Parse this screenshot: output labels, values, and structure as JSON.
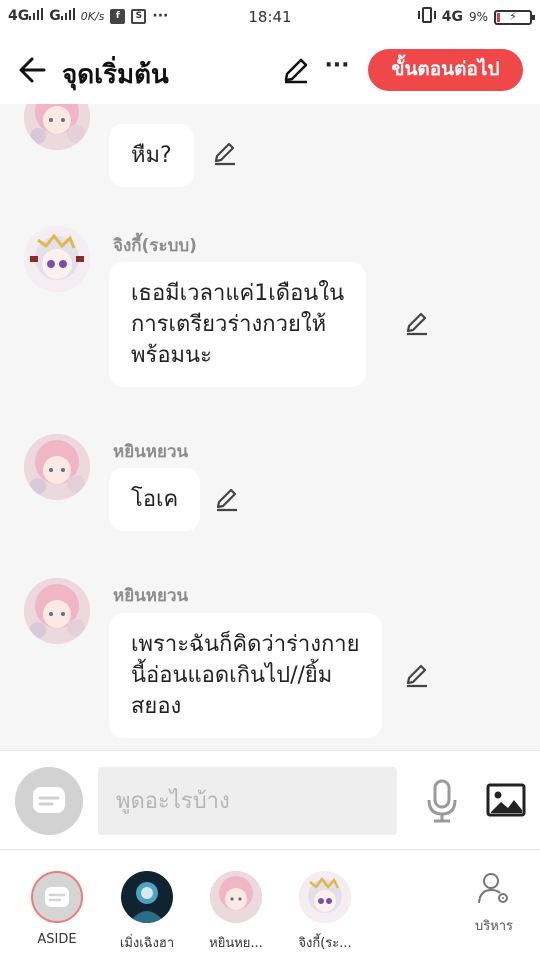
{
  "status_bar": {
    "network_left": "4G",
    "network_left2": "G",
    "speed": "0K/s",
    "app_box_1": "f",
    "app_box_2": "S",
    "more": "···",
    "time": "18:41",
    "network_right": "4G",
    "battery_pct": "9%",
    "battery_level": 0.09,
    "battery_color": "#e23b3b"
  },
  "header": {
    "title": "จุดเริ่มต้น",
    "more_label": "···",
    "next_label": "ขั้นตอนต่อไป",
    "accent_color": "#f04848"
  },
  "messages": [
    {
      "sender": "",
      "avatar": "pink-girl",
      "lines": [
        "หืม?"
      ]
    },
    {
      "sender": "จิงกี้(ระบบ)",
      "avatar": "chibi-girl",
      "lines": [
        "เธอมีเวลาแค่1เดือนใน",
        "การเตรียวร่างกวยให้",
        "พร้อมนะ"
      ]
    },
    {
      "sender": "หยินหยวน",
      "avatar": "pink-girl",
      "lines": [
        "โอเค"
      ]
    },
    {
      "sender": "หยินหยวน",
      "avatar": "pink-girl",
      "lines": [
        "เพราะฉันก็คิดว่าร่างกาย",
        "นี้อ่อนแอดเกินไป//ยิ้ม",
        "สยอง"
      ]
    }
  ],
  "input": {
    "placeholder": "พูดอะไรบ้าง"
  },
  "characters": [
    {
      "name": "ASIDE",
      "avatar": "aside-bubble"
    },
    {
      "name": "เมิ่งเฉิงฮา",
      "avatar": "dark-figure"
    },
    {
      "name": "หยินหย...",
      "avatar": "pink-girl"
    },
    {
      "name": "จิงกี้(ระ...",
      "avatar": "chibi-girl"
    }
  ],
  "manage": {
    "label": "บริหาร"
  }
}
